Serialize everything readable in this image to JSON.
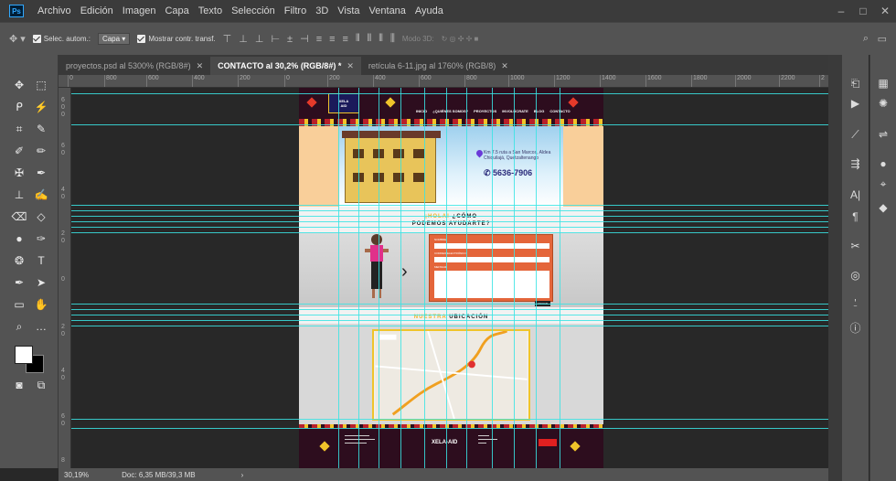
{
  "menubar": {
    "logo": "Ps",
    "items": [
      "Archivo",
      "Edición",
      "Imagen",
      "Capa",
      "Texto",
      "Selección",
      "Filtro",
      "3D",
      "Vista",
      "Ventana",
      "Ayuda"
    ]
  },
  "options": {
    "auto_select": "Selec. autom.:",
    "layer_select": "Capa",
    "show_transform": "Mostrar contr. transf.",
    "mode3d": "Modo 3D:"
  },
  "tabs": [
    {
      "label": "proyectos.psd al 5300% (RGB/8#)",
      "active": false
    },
    {
      "label": "CONTACTO al 30,2% (RGB/8#) *",
      "active": true
    },
    {
      "label": "retícula 6-11.jpg al 1760% (RGB/8)",
      "active": false
    }
  ],
  "ruler": {
    "top": [
      "0",
      "800",
      "600",
      "400",
      "200",
      "0",
      "200",
      "400",
      "600",
      "800",
      "1000",
      "1200",
      "1400",
      "1600",
      "1800",
      "2000",
      "2200",
      "2"
    ],
    "left": [
      "6\n0\n0",
      "6\n0",
      "4\n0",
      "2\n0",
      "0",
      "2\n0",
      "4\n0",
      "6\n0",
      "8"
    ]
  },
  "document": {
    "nav": [
      "INICIO",
      "¿QUIÉNES SOMOS?",
      "PROYECTOS",
      "INVOLÚCRATE",
      "BLOG",
      "CONTACTO"
    ],
    "address": "Km 7.5 ruta a San Marcos, Aldea Chiquilajá, Quetzaltenango",
    "phone": "5636-7906",
    "contact_title_hl": "¡HOLA!",
    "contact_title_1": "¿CÓMO",
    "contact_title_2": "PODEMOS AYUDARTE?",
    "form_labels": [
      "NOMBRE",
      "CORREO ELECTRÓNICO",
      "MENSAJE"
    ],
    "form_button": "ENVIAR",
    "location_hl": "NUESTRA",
    "location": "UBICACIÓN",
    "footer_brand": "XELA-AID"
  },
  "status": {
    "zoom": "30,19%",
    "doc": "Doc: 6,35 MB/39,3 MB"
  },
  "colors": {
    "guide": "#39e4e4",
    "header": "#2d0d1e",
    "accent": "#f0c42a",
    "form": "#e4653a"
  }
}
